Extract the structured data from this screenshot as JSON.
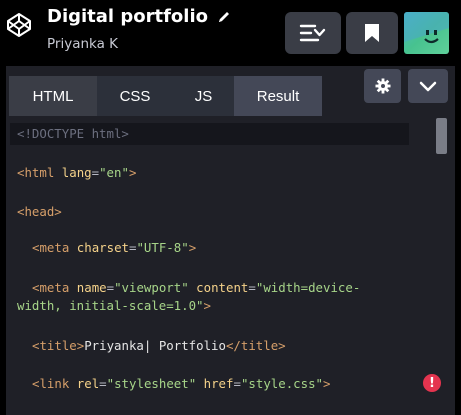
{
  "header": {
    "title": "Digital portfolio",
    "author": "Priyanka K",
    "menu_icon": "list-sort-icon",
    "bookmark_icon": "bookmark-icon",
    "avatar_icon": "smiley-avatar"
  },
  "tabs": [
    {
      "label": "HTML"
    },
    {
      "label": "CSS"
    },
    {
      "label": "JS"
    },
    {
      "label": "Result"
    }
  ],
  "toolbar": {
    "settings_icon": "gear-icon",
    "collapse_icon": "chevron-down-icon"
  },
  "code": {
    "l1": "<!DOCTYPE html>",
    "l2": {
      "open": "<html",
      "attr": "lang",
      "eq": "=",
      "val": "\"en\"",
      "close": ">"
    },
    "l3": {
      "tag": "<head>"
    },
    "l4": {
      "open": "<meta",
      "attr": "charset",
      "eq": "=",
      "val": "\"UTF-8\"",
      "close": ">"
    },
    "l5": {
      "open": "<meta",
      "attr1": "name",
      "eq1": "=",
      "val1": "\"viewport\"",
      "attr2": "content",
      "eq2": "=",
      "val2a": "\"width=device-",
      "val2b": "width, initial-scale=1.0\"",
      "close": ">"
    },
    "l6": {
      "open": "<title>",
      "text": "Priyanka| Portfolio",
      "close": "</title>"
    },
    "l7": {
      "open": "<link",
      "attr1": "rel",
      "eq1": "=",
      "val1": "\"stylesheet\"",
      "attr2": "href",
      "eq2": "=",
      "val2": "\"style.css\"",
      "close": ">"
    }
  },
  "alert_label": "!",
  "colors": {
    "tag": "#d69f6a",
    "attr": "#f5d28a",
    "string": "#a7d589",
    "alert": "#e4344f"
  }
}
